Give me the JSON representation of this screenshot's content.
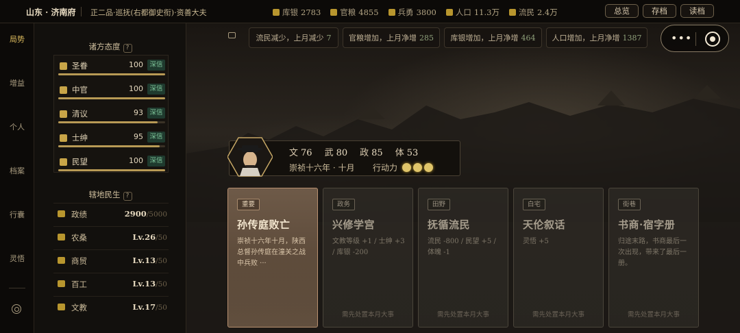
{
  "topbar": {
    "location": "山东 · 济南府",
    "rank": "正二品·巡抚(右都御史衔)·资善大夫",
    "stats": [
      {
        "label": "库银",
        "value": "2783",
        "icon": "silver-icon"
      },
      {
        "label": "官粮",
        "value": "4855",
        "icon": "grain-icon"
      },
      {
        "label": "兵勇",
        "value": "3800",
        "icon": "soldier-icon"
      },
      {
        "label": "人口",
        "value": "11.3万",
        "icon": "population-icon"
      },
      {
        "label": "流民",
        "value": "2.4万",
        "icon": "refugee-icon"
      }
    ],
    "buttons": {
      "overview": "总览",
      "save": "存档",
      "load": "读档"
    }
  },
  "leftnav": {
    "items": [
      "局势",
      "增益",
      "个人",
      "档案",
      "行囊",
      "灵悟"
    ],
    "active_index": 0
  },
  "attitudes": {
    "title": "诸方态度",
    "help": "?",
    "rows": [
      {
        "name": "圣眷",
        "value": 100,
        "badge": "深信",
        "fill": 1.0
      },
      {
        "name": "中官",
        "value": 100,
        "badge": "深信",
        "fill": 1.0
      },
      {
        "name": "清议",
        "value": 93,
        "badge": "深信",
        "fill": 0.93
      },
      {
        "name": "士绅",
        "value": 95,
        "badge": "深信",
        "fill": 0.95
      },
      {
        "name": "民望",
        "value": 100,
        "badge": "深信",
        "fill": 1.0
      }
    ]
  },
  "minsheng": {
    "title": "辖地民生",
    "help": "?",
    "rows": [
      {
        "name": "政绩",
        "value": "2900",
        "max": "/5000"
      },
      {
        "name": "农桑",
        "value": "Lv.26",
        "max": "/50"
      },
      {
        "name": "商贸",
        "value": "Lv.13",
        "max": "/50"
      },
      {
        "name": "百工",
        "value": "Lv.13",
        "max": "/50"
      },
      {
        "name": "文教",
        "value": "Lv.17",
        "max": "/50"
      }
    ]
  },
  "notices": [
    {
      "text": "流民减少，上月减少",
      "num": "7"
    },
    {
      "text": "官粮增加，上月净增",
      "num": "285"
    },
    {
      "text": "库银增加，上月净增",
      "num": "464"
    },
    {
      "text": "人口增加，上月净增",
      "num": "1387"
    }
  ],
  "character": {
    "stats": [
      {
        "label": "文",
        "value": "76"
      },
      {
        "label": "武",
        "value": "80"
      },
      {
        "label": "政",
        "value": "85"
      },
      {
        "label": "体",
        "value": "53"
      }
    ],
    "date": "崇祯十六年 · 十月",
    "action_label": "行动力",
    "action_points": 3
  },
  "events": [
    {
      "tag": "重要",
      "title": "孙传庭败亡",
      "desc": "崇祯十六年十月，陕西总督孙传庭在潼关之战中兵败 ···",
      "foot": ""
    },
    {
      "tag": "政务",
      "title": "兴修学宫",
      "desc": "文教等级 +1 / 士绅 +3 / 库银 -200",
      "foot": "需先处置本月大事"
    },
    {
      "tag": "田野",
      "title": "抚循流民",
      "desc": "流民 -800 / 民望 +5 / 体魄 -1",
      "foot": "需先处置本月大事"
    },
    {
      "tag": "白宅",
      "title": "天伦叙话",
      "desc": "灵悟 +5",
      "foot": "需先处置本月大事"
    },
    {
      "tag": "街巷",
      "title": "书商·宿字册",
      "desc": "归途末路，书商最后一次出现，带来了最后一册。",
      "foot": "需先处置本月大事"
    }
  ],
  "colors": {
    "accent": "#d9b85c",
    "badge_bg": "#1f3a2e",
    "badge_fg": "#7fc79a",
    "panel": "#12100d"
  }
}
